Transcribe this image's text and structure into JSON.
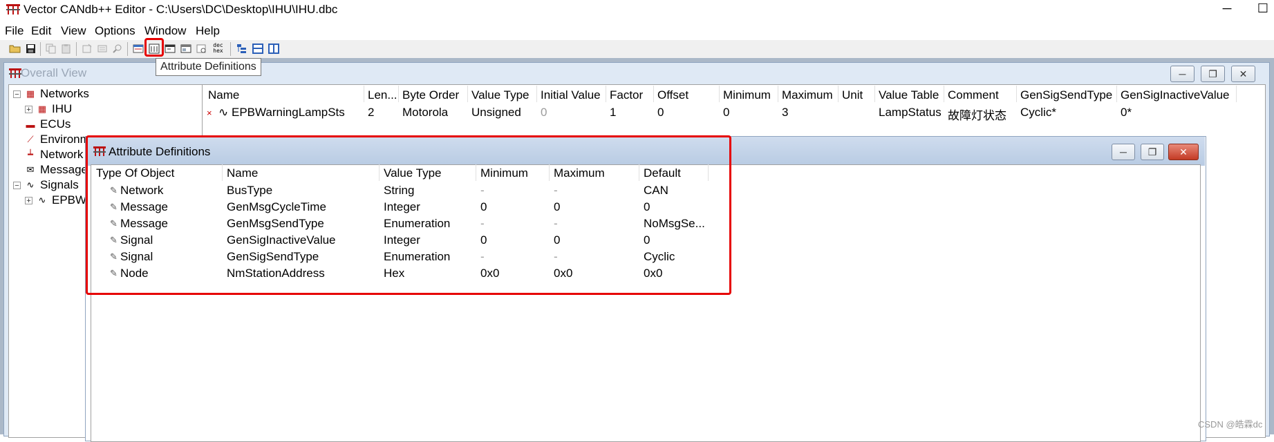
{
  "app": {
    "title": "Vector CANdb++ Editor - C:\\Users\\DC\\Desktop\\IHU\\IHU.dbc",
    "minimize": "─",
    "maximize": "☐"
  },
  "menu": [
    "File",
    "Edit",
    "View",
    "Options",
    "Window",
    "Help"
  ],
  "toolbar": {
    "tooltip": "Attribute Definitions",
    "dec_hex_label": "dec\nhex"
  },
  "overall_view": {
    "title": "Overall View",
    "tree": [
      {
        "label": "Networks",
        "toggle": "−",
        "icon": "network-icon"
      },
      {
        "label": "IHU",
        "toggle": "+",
        "icon": "network-icon"
      },
      {
        "label": "ECUs",
        "icon": "ecu-icon"
      },
      {
        "label": "Environm",
        "icon": "env-icon"
      },
      {
        "label": "Network",
        "icon": "node-icon"
      },
      {
        "label": "Message",
        "icon": "message-icon"
      },
      {
        "label": "Signals",
        "toggle": "−",
        "icon": "signal-icon"
      },
      {
        "label": "EPBWa",
        "toggle": "+",
        "icon": "signal-icon"
      }
    ],
    "columns": [
      "Name",
      "Len...",
      "Byte Order",
      "Value Type",
      "Initial Value",
      "Factor",
      "Offset",
      "Minimum",
      "Maximum",
      "Unit",
      "Value Table",
      "Comment",
      "GenSigSendType",
      "GenSigInactiveValue"
    ],
    "row": {
      "name": "EPBWarningLampSts",
      "length": "2",
      "byte_order": "Motorola",
      "value_type": "Unsigned",
      "initial_value": "0",
      "factor": "1",
      "offset": "0",
      "minimum": "0",
      "maximum": "3",
      "unit": "",
      "value_table": "LampStatus",
      "comment": "故障灯状态",
      "gen_sig_send_type": "Cyclic*",
      "gen_sig_inactive_value": "0*"
    }
  },
  "attribute_definitions": {
    "title": "Attribute Definitions",
    "columns": [
      "Type Of Object",
      "Name",
      "Value Type",
      "Minimum",
      "Maximum",
      "Default"
    ],
    "rows": [
      [
        "Network",
        "BusType",
        "String",
        "-",
        "-",
        "CAN"
      ],
      [
        "Message",
        "GenMsgCycleTime",
        "Integer",
        "0",
        "0",
        "0"
      ],
      [
        "Message",
        "GenMsgSendType",
        "Enumeration",
        "-",
        "-",
        "NoMsgSe..."
      ],
      [
        "Signal",
        "GenSigInactiveValue",
        "Integer",
        "0",
        "0",
        "0"
      ],
      [
        "Signal",
        "GenSigSendType",
        "Enumeration",
        "-",
        "-",
        "Cyclic"
      ],
      [
        "Node",
        "NmStationAddress",
        "Hex",
        "0x0",
        "0x0",
        "0x0"
      ]
    ]
  },
  "watermark": "CSDN @皓霖dc",
  "colors": {
    "highlight": "#e60000",
    "mdi_background": "#abb8c8",
    "caption": "#b8cbe3"
  }
}
